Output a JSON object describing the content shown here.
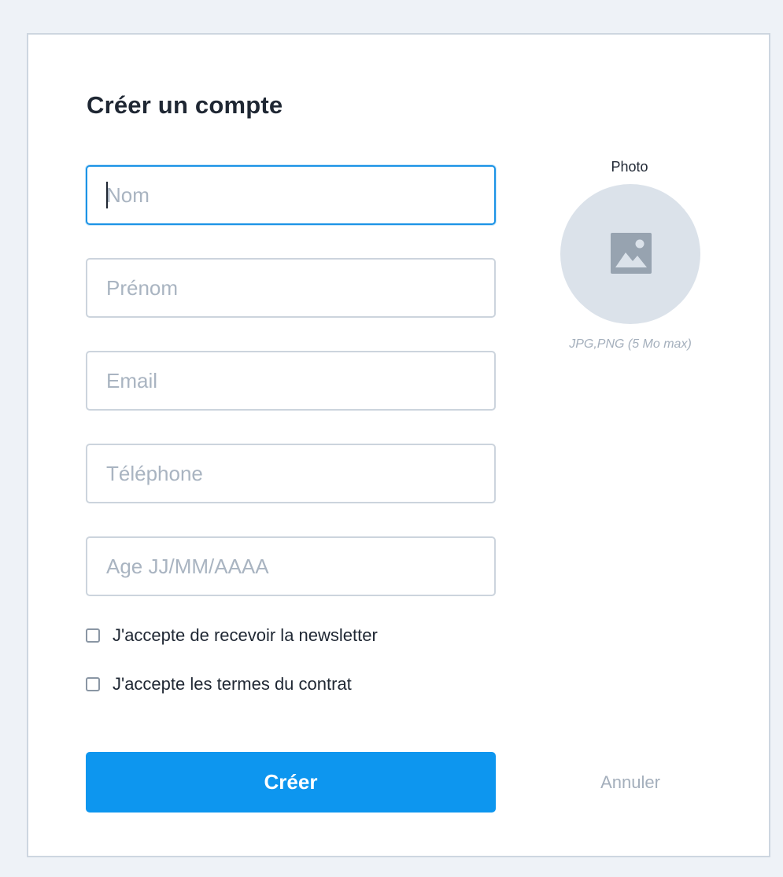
{
  "form": {
    "title": "Créer un compte",
    "fields": {
      "nom": {
        "placeholder": "Nom",
        "value": ""
      },
      "prenom": {
        "placeholder": "Prénom",
        "value": ""
      },
      "email": {
        "placeholder": "Email",
        "value": ""
      },
      "telephone": {
        "placeholder": "Téléphone",
        "value": ""
      },
      "age": {
        "placeholder": "Age JJ/MM/AAAA",
        "value": ""
      }
    },
    "checkboxes": [
      {
        "label": "J'accepte de recevoir la newsletter",
        "checked": false
      },
      {
        "label": "J'accepte les termes du contrat",
        "checked": false
      }
    ],
    "submit_label": "Créer",
    "cancel_label": "Annuler"
  },
  "photo": {
    "label": "Photo",
    "hint": "JPG,PNG (5 Mo max)",
    "icon": "image-icon"
  },
  "colors": {
    "accent": "#0d96ef",
    "focus_border": "#1b93e6",
    "muted_text": "#a4afbc",
    "avatar_bg": "#dbe2ea",
    "page_bg": "#eef2f7"
  }
}
